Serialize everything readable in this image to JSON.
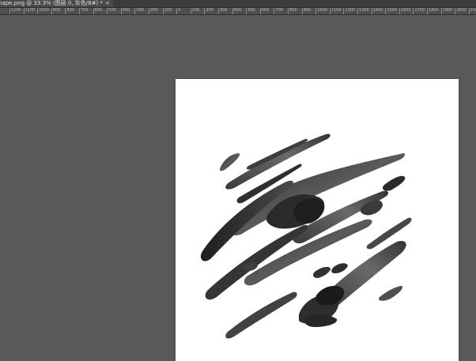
{
  "document_tab": {
    "title": "nape.png @ 33.3% (图层 0, 灰色/8#) *",
    "close_glyph": "×"
  },
  "ruler": {
    "labels": [
      "1200",
      "1100",
      "1000",
      "900",
      "800",
      "700",
      "600",
      "500",
      "400",
      "300",
      "200",
      "100",
      "0",
      "100",
      "200",
      "300",
      "400",
      "500",
      "600",
      "700",
      "800",
      "900",
      "1000",
      "1100",
      "1200",
      "1300",
      "1400",
      "1500",
      "1600",
      "1700",
      "1800",
      "1900",
      "2000",
      "2100"
    ]
  },
  "colors": {
    "workspace": "#595959",
    "tabbar": "#3c3c3c",
    "ruler": "#4f4f4f",
    "canvas": "#ffffff",
    "ink": "#3a3a3a"
  }
}
